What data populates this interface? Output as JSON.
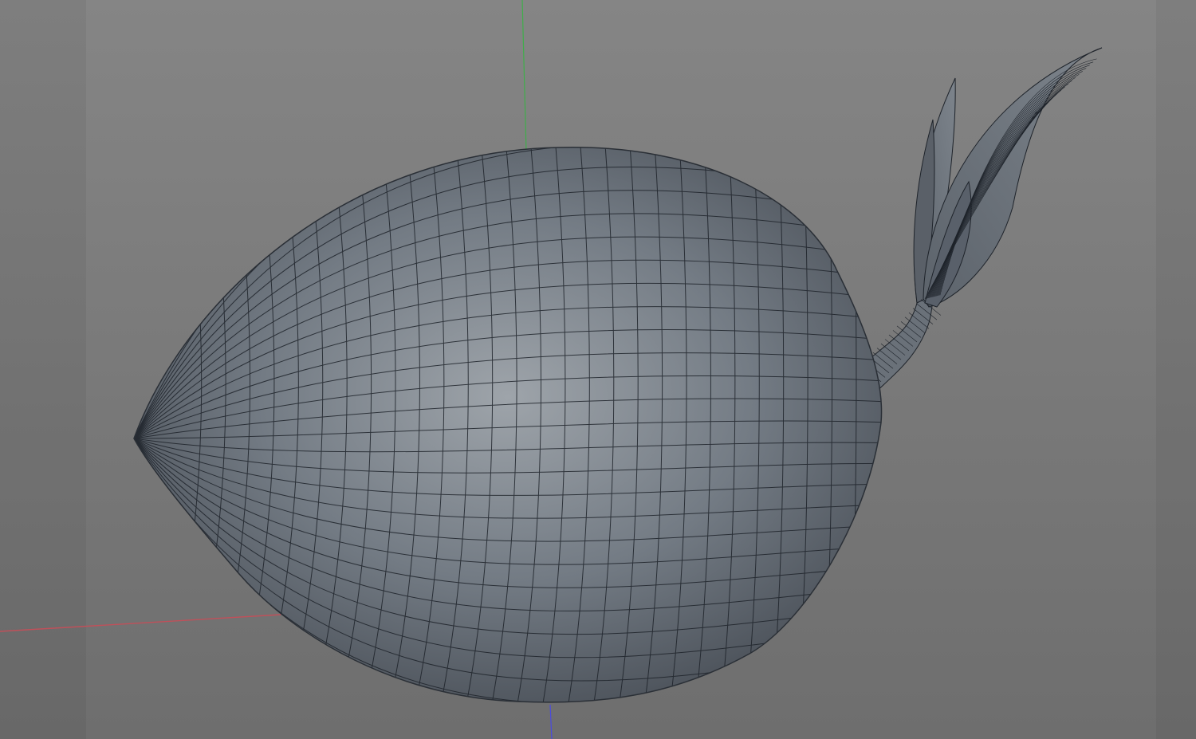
{
  "viewport": {
    "background_color": "#838383",
    "side_band_color": "#7b7b7b",
    "mesh_color": "#6f7780",
    "wire_color": "#1e232a",
    "axis_colors": {
      "x": "#c0505a",
      "y": "#3fae4a",
      "z": "#4a4adf"
    }
  }
}
